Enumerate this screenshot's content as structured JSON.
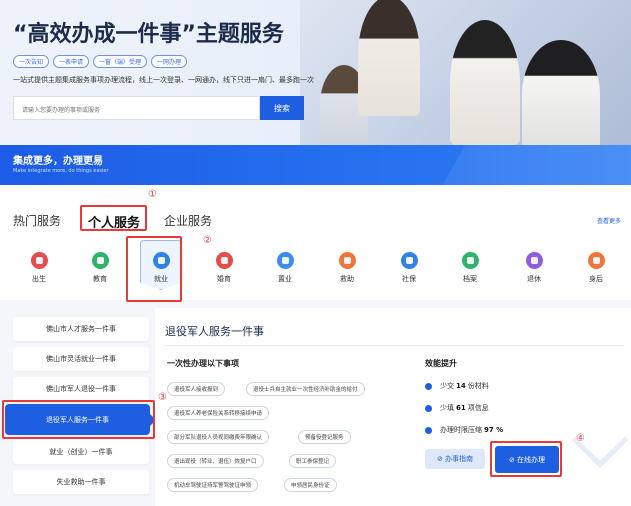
{
  "hero": {
    "title": "“高效办成一件事”主题服务",
    "tags": [
      "一次告知",
      "一表申请",
      "一窗（端）受理",
      "一网办理"
    ],
    "description": "一站式提供主题集成服务事项办理流程，线上一次登录、一网通办，线下只进一扇门、最多跑一次",
    "search_placeholder": "请输入您要办理的事项或服务",
    "search_label": "搜索"
  },
  "banner": {
    "title": "集成更多，办理更易",
    "subtitle": "Make integrate more, do things easier"
  },
  "service_tabs": {
    "hot": "热门服务",
    "personal": "个人服务",
    "enterprise": "企业服务",
    "see_more": "查看更多"
  },
  "badges": [
    "①",
    "②",
    "③",
    "④"
  ],
  "categories": [
    {
      "label": "出生",
      "color": "#e54d4d"
    },
    {
      "label": "教育",
      "color": "#2fb46a"
    },
    {
      "label": "就业",
      "color": "#2f82e8"
    },
    {
      "label": "婚育",
      "color": "#e54d4d"
    },
    {
      "label": "置业",
      "color": "#3d8cf0"
    },
    {
      "label": "救助",
      "color": "#f0753b"
    },
    {
      "label": "社保",
      "color": "#2f82e8"
    },
    {
      "label": "档案",
      "color": "#2fb46a"
    },
    {
      "label": "退休",
      "color": "#8e5ee0"
    },
    {
      "label": "身后",
      "color": "#f0753b"
    }
  ],
  "left_menu": [
    "佛山市人才服务一件事",
    "佛山市灵活就业一件事",
    "佛山市军人退役一件事",
    "退役军人服务一件事",
    "就业（创业）一件事",
    "失业救助一件事"
  ],
  "panel": {
    "title": "退役军人服务一件事",
    "section_once": "一次性办理以下事项",
    "section_efficiency": "效能提升",
    "chips": [
      "退役军人接收报到",
      "退役士兵自主就业一次性经济补助金的给付",
      "退役军人养老保险关系转移接续申请",
      "部分军队退役人员视同缴费年限确认",
      "预备役登记服务",
      "退出现役（转业、退伍）恢复户口",
      "职工参保登记",
      "机动车驾驶证持军警驾驶证申领",
      "申领居民身份证"
    ],
    "efficiency": [
      {
        "prefix": "少交",
        "value": "14",
        "suffix": "份材料"
      },
      {
        "prefix": "少填",
        "value": "61",
        "suffix": "项信息"
      },
      {
        "prefix": "办理时限压缩",
        "value": "97 %",
        "suffix": ""
      }
    ],
    "btn_guide": "⊘ 办事指南",
    "btn_online": "⊘ 在线办理"
  }
}
